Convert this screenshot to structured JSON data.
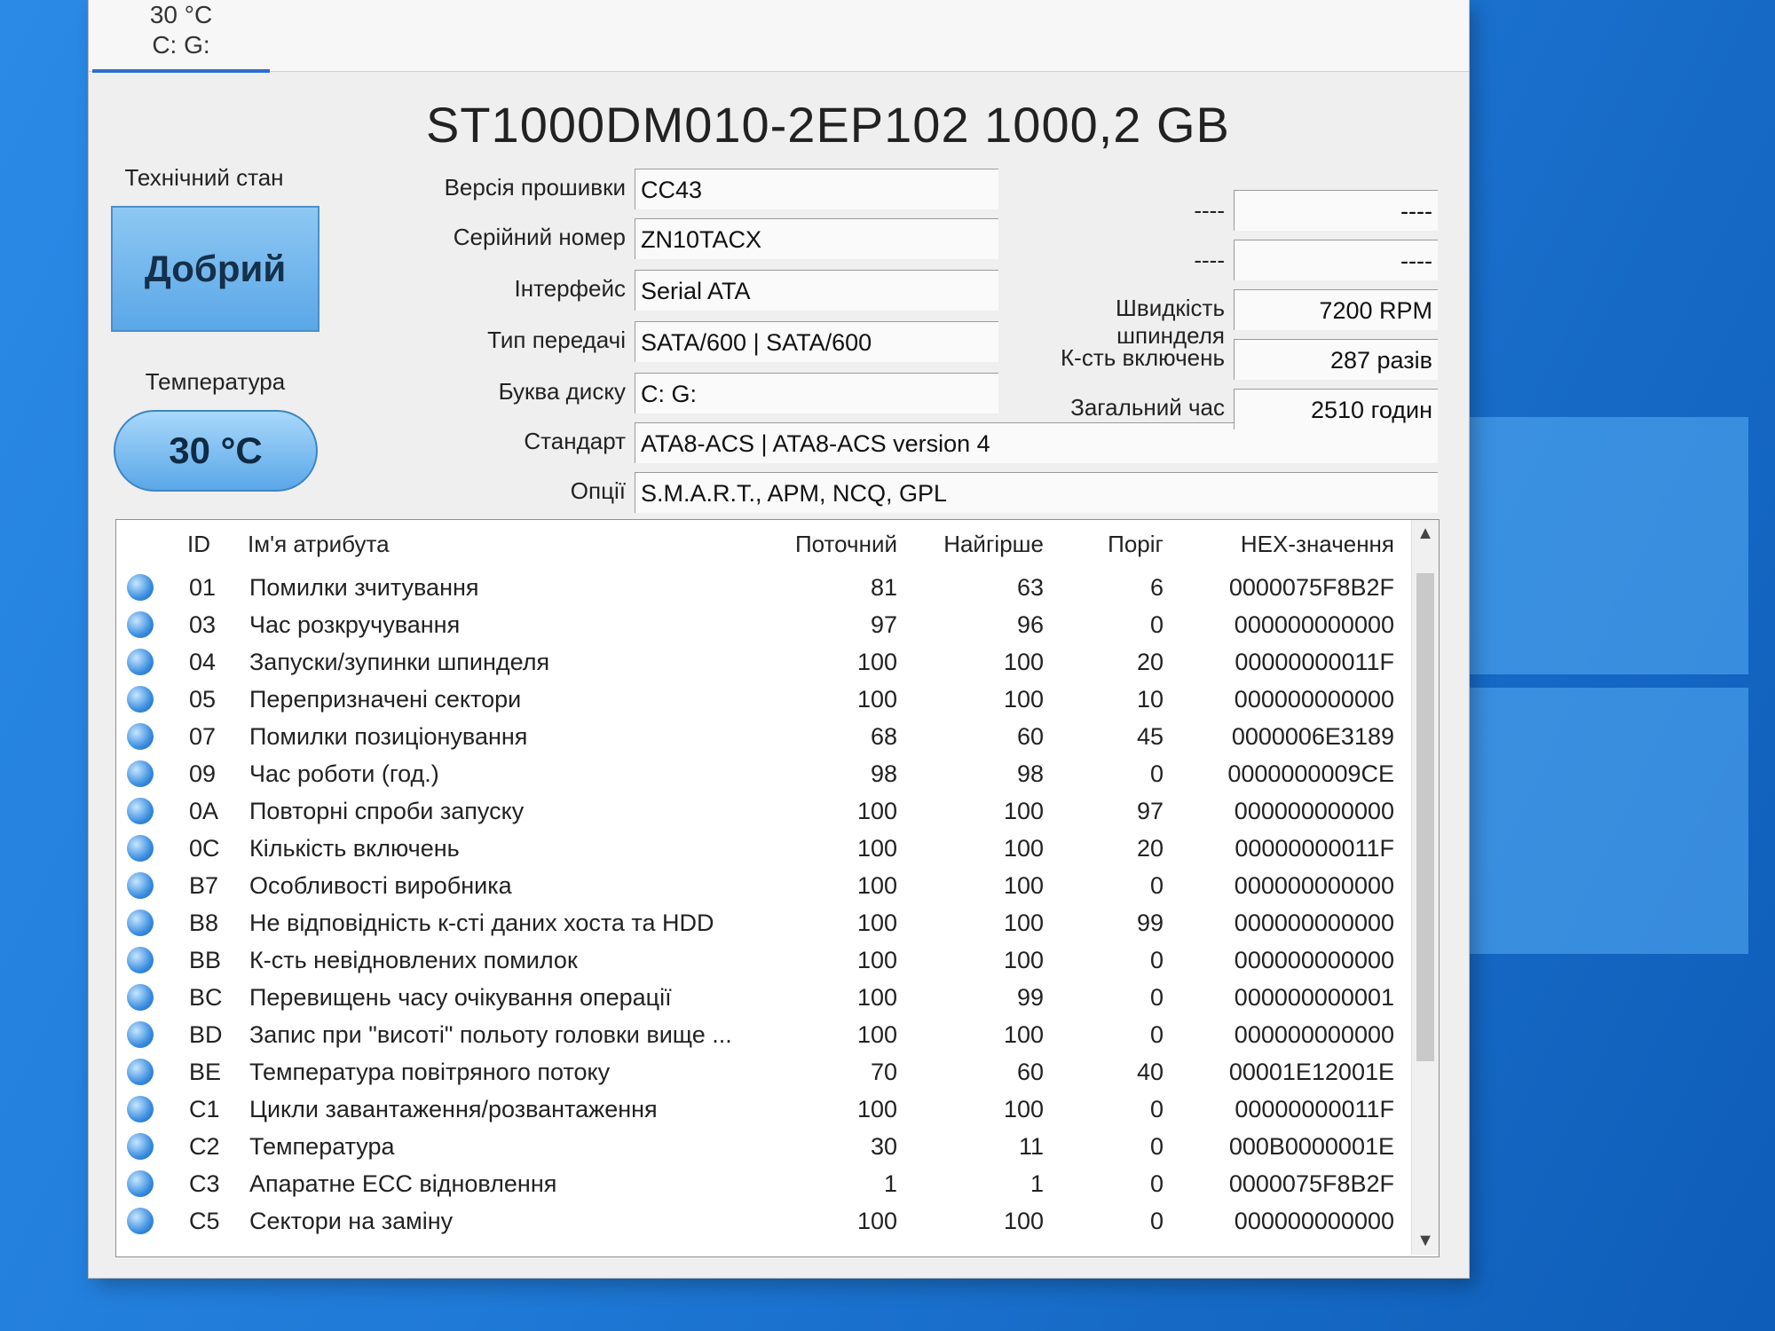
{
  "drive_tab": {
    "temperature": "30 °C",
    "letters": "C: G:"
  },
  "title": "ST1000DM010-2EP102 1000,2 GB",
  "health": {
    "label": "Технічний стан",
    "value": "Добрий"
  },
  "temperature": {
    "label": "Температура",
    "value": "30 °C"
  },
  "info": {
    "firmware": {
      "label": "Версія прошивки",
      "value": "CC43"
    },
    "serial": {
      "label": "Серійний номер",
      "value": "ZN10TACX"
    },
    "interface": {
      "label": "Інтерфейс",
      "value": "Serial ATA"
    },
    "transfer": {
      "label": "Тип передачі",
      "value": "SATA/600 | SATA/600"
    },
    "drive_letter": {
      "label": "Буква диску",
      "value": "C: G:"
    },
    "standard": {
      "label": "Стандарт",
      "value": "ATA8-ACS | ATA8-ACS version 4"
    },
    "options": {
      "label": "Опції",
      "value": "S.M.A.R.T., APM, NCQ, GPL"
    }
  },
  "right_info": {
    "blank1": {
      "label": "----",
      "value": "----"
    },
    "blank2": {
      "label": "----",
      "value": "----"
    },
    "rpm": {
      "label": "Швидкість шпинделя",
      "value": "7200 RPM"
    },
    "power_count": {
      "label": "К-сть включень",
      "value": "287 разів"
    },
    "total_time": {
      "label": "Загальний час",
      "value": "2510 годин"
    }
  },
  "table": {
    "headers": {
      "id": "ID",
      "name": "Ім'я атрибута",
      "current": "Поточний",
      "worst": "Найгірше",
      "threshold": "Поріг",
      "raw": "HEX-значення"
    },
    "rows": [
      {
        "id": "01",
        "name": "Помилки зчитування",
        "current": "81",
        "worst": "63",
        "threshold": "6",
        "raw": "0000075F8B2F"
      },
      {
        "id": "03",
        "name": "Час розкручування",
        "current": "97",
        "worst": "96",
        "threshold": "0",
        "raw": "000000000000"
      },
      {
        "id": "04",
        "name": "Запуски/зупинки шпинделя",
        "current": "100",
        "worst": "100",
        "threshold": "20",
        "raw": "00000000011F"
      },
      {
        "id": "05",
        "name": "Перепризначені сектори",
        "current": "100",
        "worst": "100",
        "threshold": "10",
        "raw": "000000000000"
      },
      {
        "id": "07",
        "name": "Помилки позиціонування",
        "current": "68",
        "worst": "60",
        "threshold": "45",
        "raw": "0000006E3189"
      },
      {
        "id": "09",
        "name": "Час роботи (год.)",
        "current": "98",
        "worst": "98",
        "threshold": "0",
        "raw": "0000000009CE"
      },
      {
        "id": "0A",
        "name": "Повторні спроби запуску",
        "current": "100",
        "worst": "100",
        "threshold": "97",
        "raw": "000000000000"
      },
      {
        "id": "0C",
        "name": "Кількість включень",
        "current": "100",
        "worst": "100",
        "threshold": "20",
        "raw": "00000000011F"
      },
      {
        "id": "B7",
        "name": "Особливості виробника",
        "current": "100",
        "worst": "100",
        "threshold": "0",
        "raw": "000000000000"
      },
      {
        "id": "B8",
        "name": "Не відповідність к-сті даних хоста та HDD",
        "current": "100",
        "worst": "100",
        "threshold": "99",
        "raw": "000000000000"
      },
      {
        "id": "BB",
        "name": "К-сть невідновлених помилок",
        "current": "100",
        "worst": "100",
        "threshold": "0",
        "raw": "000000000000"
      },
      {
        "id": "BC",
        "name": "Перевищень часу очікування операції",
        "current": "100",
        "worst": "99",
        "threshold": "0",
        "raw": "000000000001"
      },
      {
        "id": "BD",
        "name": "Запис при \"висоті\" польоту головки вище ...",
        "current": "100",
        "worst": "100",
        "threshold": "0",
        "raw": "000000000000"
      },
      {
        "id": "BE",
        "name": "Температура повітряного потоку",
        "current": "70",
        "worst": "60",
        "threshold": "40",
        "raw": "00001E12001E"
      },
      {
        "id": "C1",
        "name": "Цикли завантаження/розвантаження",
        "current": "100",
        "worst": "100",
        "threshold": "0",
        "raw": "00000000011F"
      },
      {
        "id": "C2",
        "name": "Температура",
        "current": "30",
        "worst": "11",
        "threshold": "0",
        "raw": "000B0000001E"
      },
      {
        "id": "C3",
        "name": "Апаратне ECC відновлення",
        "current": "1",
        "worst": "1",
        "threshold": "0",
        "raw": "0000075F8B2F"
      },
      {
        "id": "C5",
        "name": "Сектори на заміну",
        "current": "100",
        "worst": "100",
        "threshold": "0",
        "raw": "000000000000"
      }
    ]
  },
  "scroll": {
    "up_icon": "chevron-up-icon",
    "down_icon": "chevron-down-icon"
  }
}
